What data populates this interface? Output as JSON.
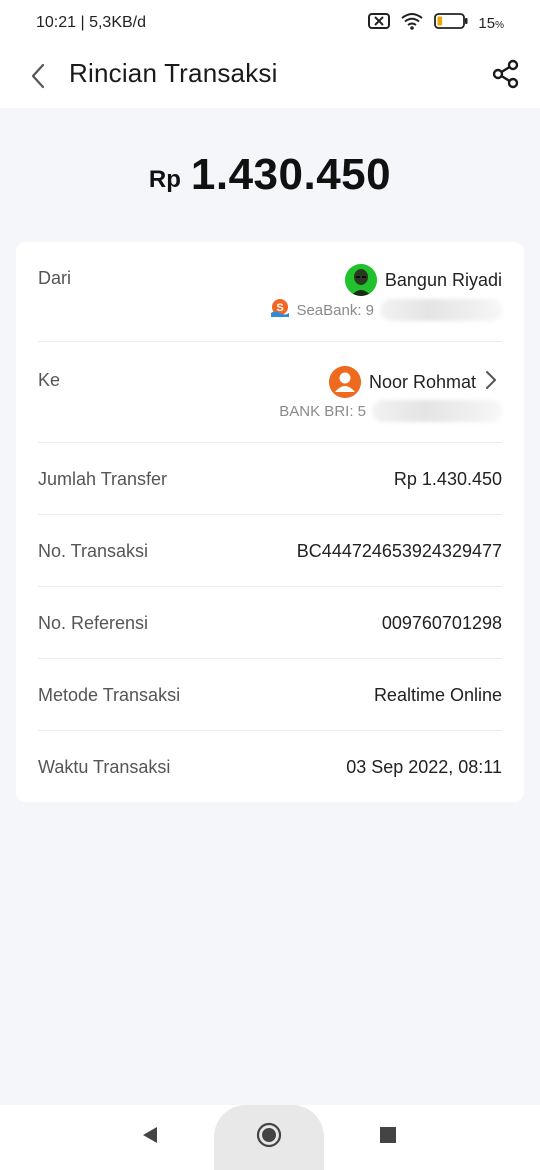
{
  "status": {
    "time": "10:21 | 5,3KB/d",
    "battery": "15",
    "battery_unit": "%"
  },
  "header": {
    "title": "Rincian Transaksi"
  },
  "amount": {
    "currency": "Rp",
    "value": "1.430.450"
  },
  "from": {
    "label": "Dari",
    "name": "Bangun Riyadi",
    "bank": "SeaBank: 9"
  },
  "to": {
    "label": "Ke",
    "name": "Noor Rohmat",
    "bank": "BANK BRI: 5"
  },
  "details": [
    {
      "label": "Jumlah Transfer",
      "value": "Rp 1.430.450"
    },
    {
      "label": "No. Transaksi",
      "value": "BC444724653924329477"
    },
    {
      "label": "No. Referensi",
      "value": "009760701298"
    },
    {
      "label": "Metode Transaksi",
      "value": "Realtime Online"
    },
    {
      "label": "Waktu Transaksi",
      "value": "03 Sep 2022, 08:11"
    }
  ],
  "colors": {
    "accent": "#ee5a24",
    "seabank": "#f26522",
    "avatar_green": "#22c22e"
  },
  "icons": [
    "back-arrow-icon",
    "share-icon",
    "seabank-logo-icon",
    "user-avatar-icon",
    "chevron-right-icon",
    "nav-back-icon",
    "nav-home-icon",
    "nav-recents-icon"
  ]
}
